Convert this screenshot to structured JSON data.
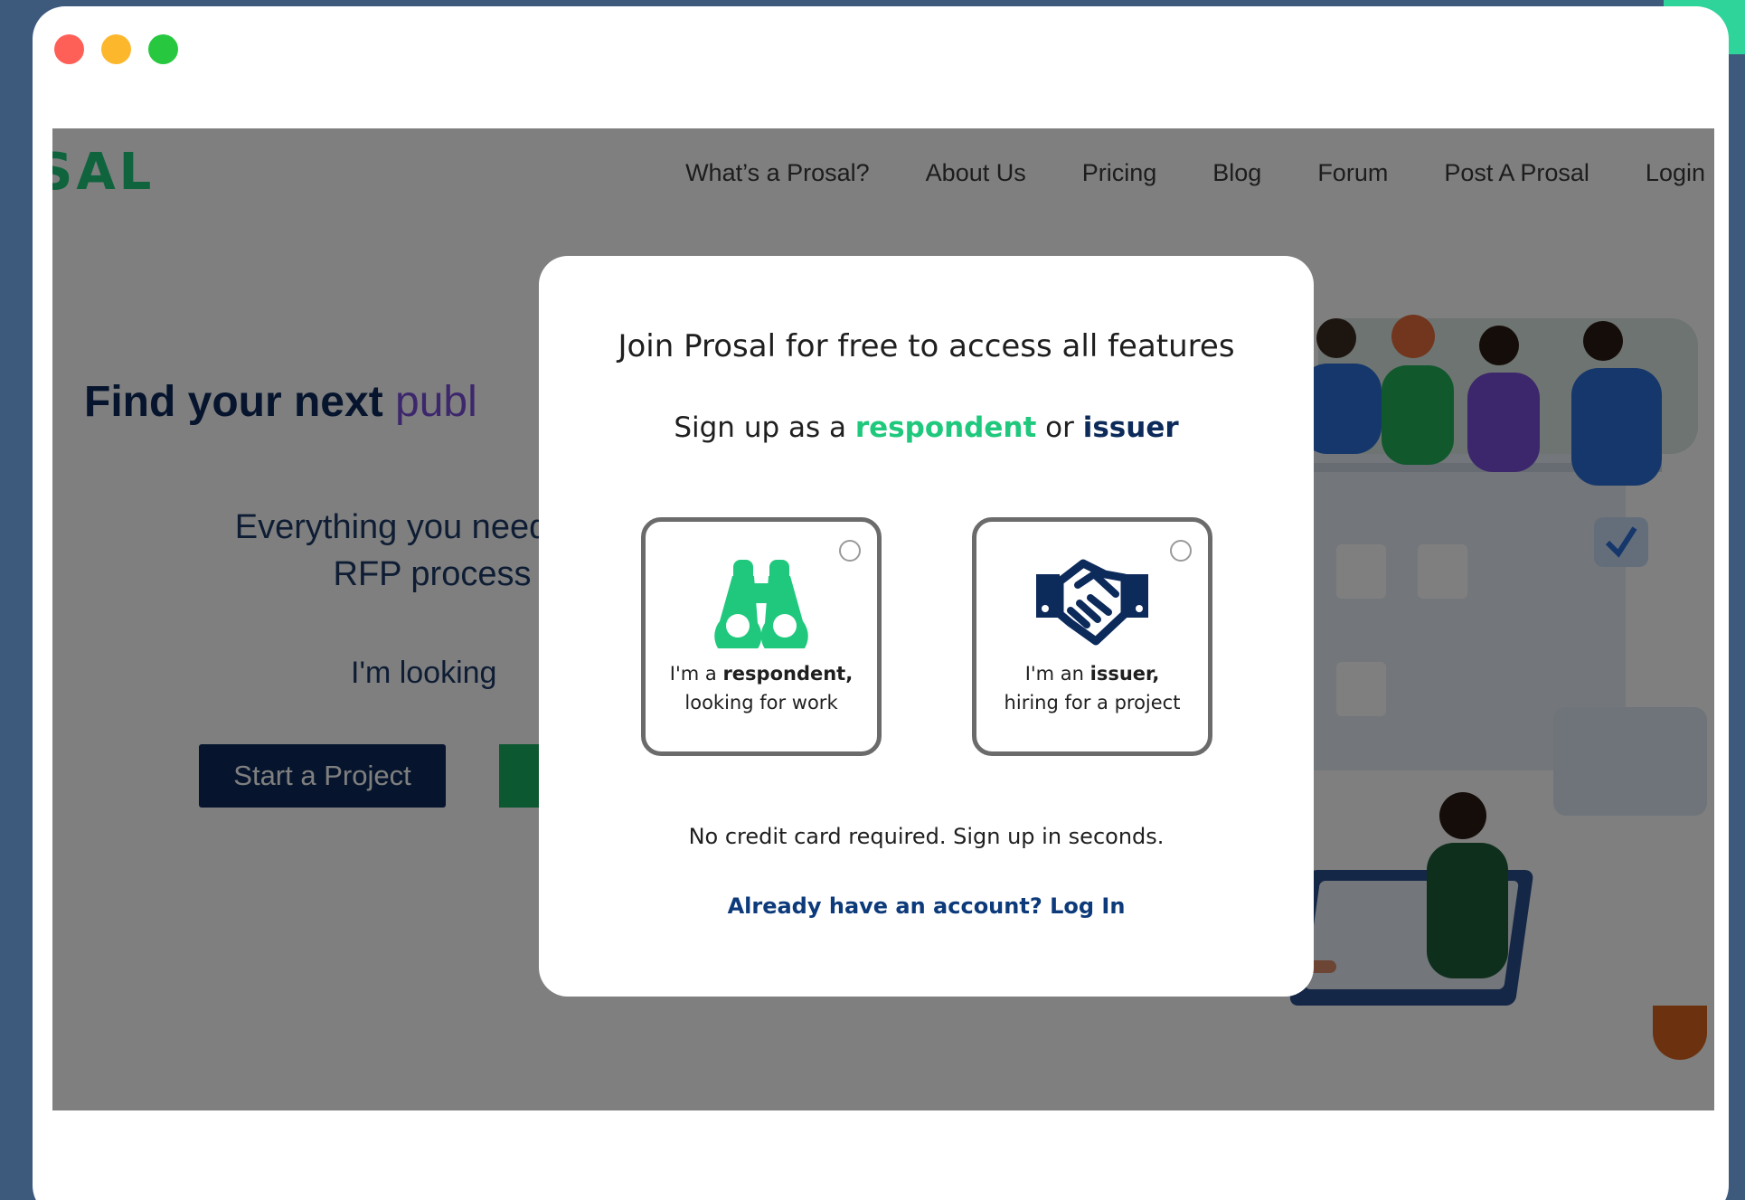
{
  "browser": {
    "controls": [
      "close",
      "minimize",
      "maximize"
    ]
  },
  "site": {
    "logo": "SAL",
    "nav": [
      "What’s a Prosal?",
      "About Us",
      "Pricing",
      "Blog",
      "Forum",
      "Post A Prosal",
      "Login"
    ],
    "hero": {
      "title_main": "Find your next",
      "title_accent": "publ",
      "subtitle_line1": "Everything you need",
      "subtitle_line2": "RFP process",
      "looking": "I'm looking",
      "start_button": "Start a Project"
    }
  },
  "modal": {
    "title": "Join Prosal for free to access all features",
    "subtitle_prefix": "Sign up as a",
    "subtitle_respondent": "respondent",
    "subtitle_or": "or",
    "subtitle_issuer": "issuer",
    "respondent_card": {
      "prefix": "I'm a",
      "role": "respondent,",
      "desc": "looking for work"
    },
    "issuer_card": {
      "prefix": "I'm an",
      "role": "issuer,",
      "desc": "hiring for a project"
    },
    "note": "No credit card required. Sign up in seconds.",
    "login_link": "Already have an account? Log In"
  },
  "colors": {
    "brand_green": "#1fc87c",
    "brand_navy": "#0c2a5a",
    "accent_purple": "#7a4fd8"
  },
  "icons": {
    "respondent": "binoculars-icon",
    "issuer": "handshake-icon"
  }
}
